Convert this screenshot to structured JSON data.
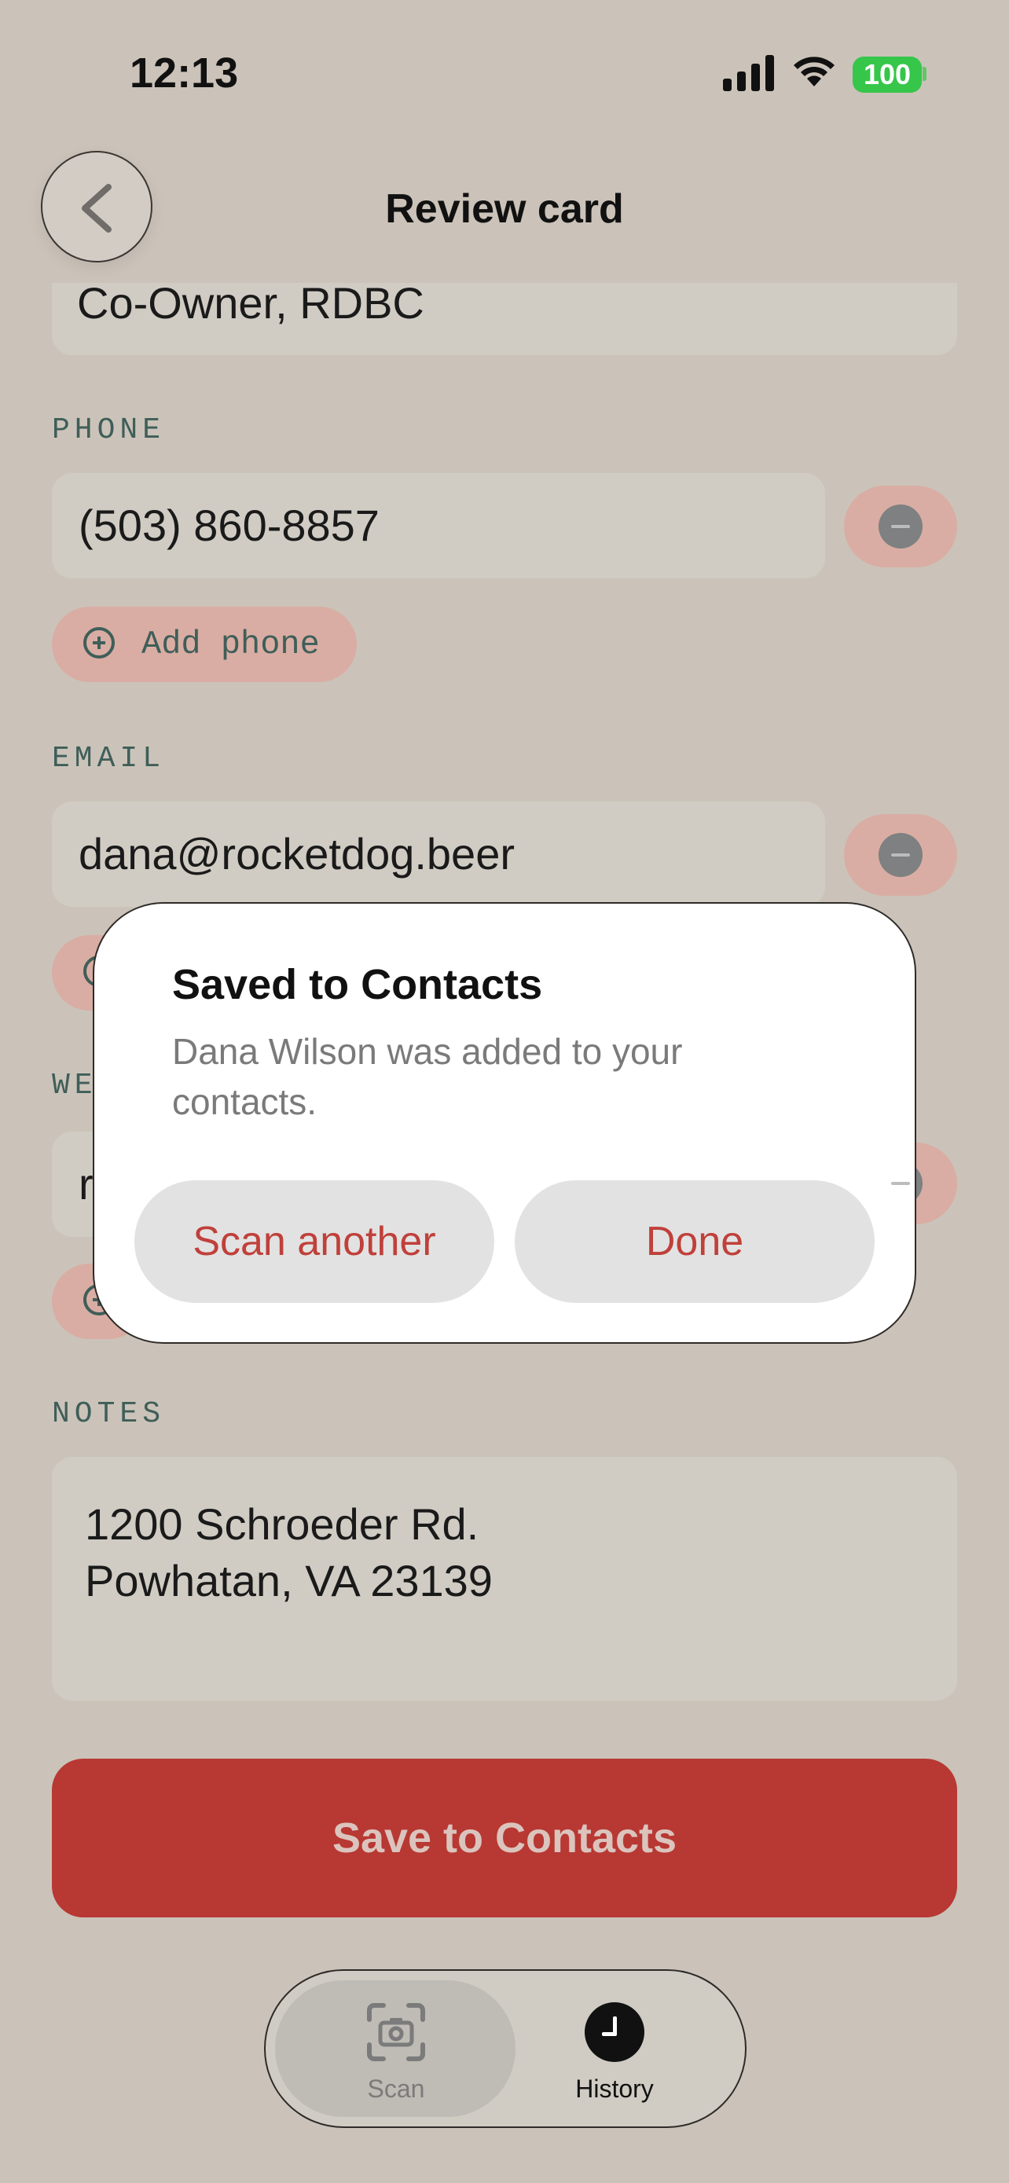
{
  "status": {
    "time": "12:13",
    "battery": "100"
  },
  "header": {
    "title": "Review card"
  },
  "form": {
    "title_value": "Co-Owner, RDBC",
    "phone": {
      "label": "PHONE",
      "value": "(503) 860-8857",
      "add_label": "Add phone"
    },
    "email": {
      "label": "EMAIL",
      "value": "dana@rocketdog.beer"
    },
    "website": {
      "label_partial": "WE",
      "value_partial": "r"
    },
    "notes": {
      "label": "NOTES",
      "lines": [
        "1200 Schroeder Rd.",
        "Powhatan, VA 23139"
      ]
    },
    "save_button": "Save to Contacts"
  },
  "dialog": {
    "title": "Saved to Contacts",
    "message": "Dana Wilson was added to your contacts.",
    "scan_another": "Scan another",
    "done": "Done"
  },
  "tabbar": {
    "scan": "Scan",
    "history": "History"
  },
  "colors": {
    "accent": "#b83833",
    "background": "#cbc3b9",
    "label": "#3f5e59"
  }
}
